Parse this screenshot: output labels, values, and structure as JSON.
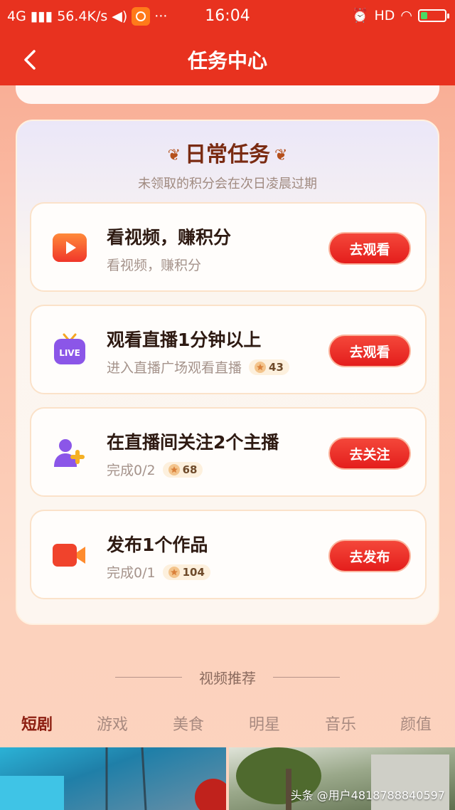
{
  "status_bar": {
    "network": "4G",
    "speed": "56.4K/s",
    "dots": "···",
    "time": "16:04",
    "hd": "HD"
  },
  "nav": {
    "title": "任务中心"
  },
  "daily": {
    "title": "日常任务",
    "subtitle": "未领取的积分会在次日凌晨过期",
    "tasks": [
      {
        "name": "看视频，赚积分",
        "desc": "看视频，赚积分",
        "reward": "",
        "button": "去观看",
        "icon": "video-play-icon"
      },
      {
        "name": "观看直播1分钟以上",
        "desc": "进入直播广场观看直播",
        "reward": "43",
        "button": "去观看",
        "icon": "live-tv-icon"
      },
      {
        "name": "在直播间关注2个主播",
        "desc": "完成0/2",
        "reward": "68",
        "button": "去关注",
        "icon": "add-follow-icon"
      },
      {
        "name": "发布1个作品",
        "desc": "完成0/1",
        "reward": "104",
        "button": "去发布",
        "icon": "video-camera-icon"
      }
    ]
  },
  "recommend": {
    "title": "视频推荐",
    "tabs": [
      "短剧",
      "游戏",
      "美食",
      "明星",
      "音乐",
      "颜值"
    ],
    "active_tab": "短剧"
  },
  "watermark": "头条 @用户4818788840597"
}
